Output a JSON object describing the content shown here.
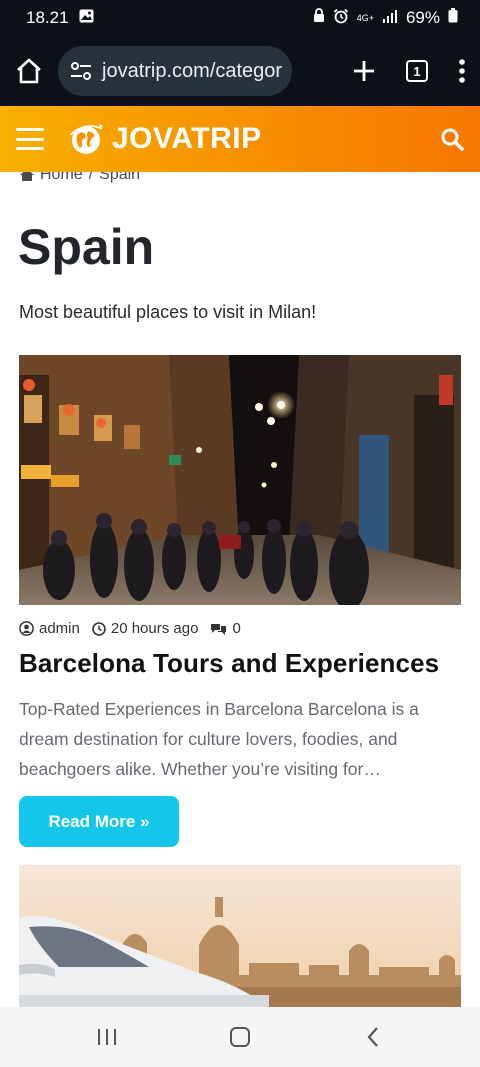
{
  "status_bar": {
    "time": "18.21",
    "network": "4G+",
    "battery": "69%"
  },
  "browser": {
    "url": "jovatrip.com/categor",
    "tab_count": "1"
  },
  "site": {
    "logo_text": "JOVATRIP",
    "brand_gradient": [
      "#f7b000",
      "#f77700"
    ]
  },
  "breadcrumb": {
    "home": "Home",
    "separator": "/",
    "current": "Spain"
  },
  "page": {
    "title": "Spain",
    "description": "Most beautiful places to visit in Milan!"
  },
  "post": {
    "author": "admin",
    "time_ago": "20 hours ago",
    "comments": "0",
    "title": "Barcelona Tours and Experiences",
    "excerpt": "Top-Rated Experiences in Barcelona Barcelona is a dream destination for culture lovers, foodies, and beachgoers alike. Whether you’re visiting for…",
    "read_more": "Read More »",
    "accent_color": "#14c6ea"
  },
  "icons": {
    "home": "home-icon",
    "site_settings": "tune-icon",
    "new_tab": "plus-icon",
    "menu": "more-vert-icon",
    "hamburger": "hamburger-icon",
    "search": "search-icon",
    "user": "user-icon",
    "clock": "clock-icon",
    "comments": "comments-icon"
  }
}
